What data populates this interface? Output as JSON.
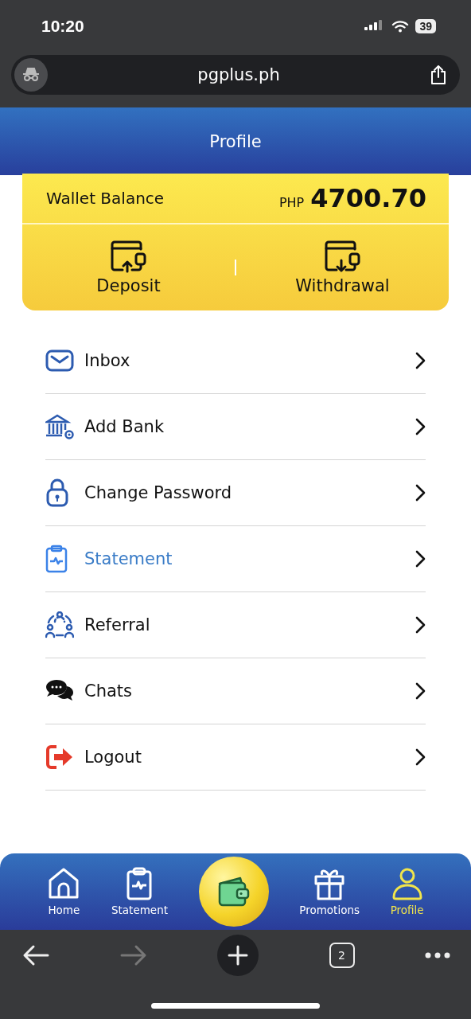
{
  "status_bar": {
    "time": "10:20",
    "battery": "39"
  },
  "browser": {
    "url": "pgplus.ph",
    "tab_count": "2"
  },
  "header": {
    "title": "Profile"
  },
  "wallet": {
    "label": "Wallet Balance",
    "currency": "PHP",
    "amount": "4700.70",
    "actions": [
      {
        "kind": "deposit",
        "label": "Deposit"
      },
      {
        "kind": "withdrawal",
        "label": "Withdrawal"
      }
    ]
  },
  "menu": [
    {
      "kind": "inbox",
      "label": "Inbox",
      "selected": false
    },
    {
      "kind": "bank",
      "label": "Add Bank",
      "selected": false
    },
    {
      "kind": "lock",
      "label": "Change Password",
      "selected": false
    },
    {
      "kind": "statement",
      "label": "Statement",
      "selected": true
    },
    {
      "kind": "referral",
      "label": "Referral",
      "selected": false
    },
    {
      "kind": "chats",
      "label": "Chats",
      "selected": false
    },
    {
      "kind": "logout",
      "label": "Logout",
      "selected": false
    }
  ],
  "bottom_nav": [
    {
      "kind": "home",
      "label": "Home",
      "selected": false
    },
    {
      "kind": "statement",
      "label": "Statement",
      "selected": false
    },
    {
      "kind": "wallet"
    },
    {
      "kind": "gift",
      "label": "Promotions",
      "selected": false
    },
    {
      "kind": "person",
      "label": "Profile",
      "selected": true
    }
  ]
}
